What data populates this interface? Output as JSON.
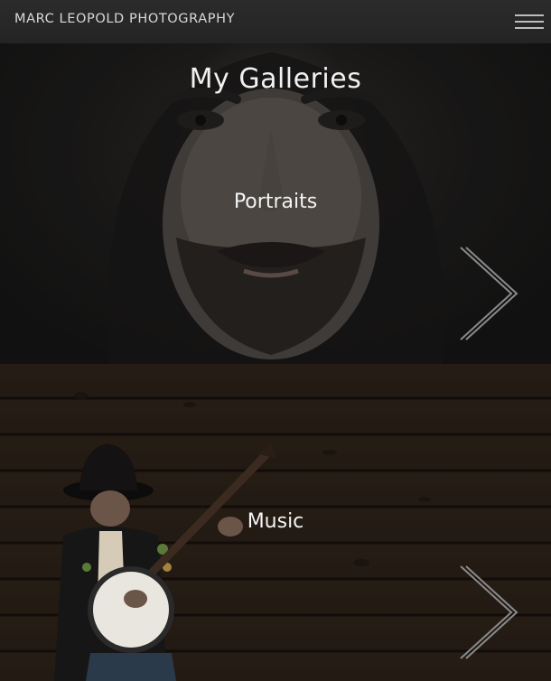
{
  "header": {
    "site_title": "MARC LEOPOLD PHOTOGRAPHY",
    "menu_icon": "hamburger-menu-icon"
  },
  "main": {
    "heading": "My Galleries",
    "galleries": [
      {
        "label": "Portraits",
        "icon": "chevron-right-icon"
      },
      {
        "label": "Music",
        "icon": "chevron-right-icon"
      }
    ]
  },
  "colors": {
    "header_background": "#272727",
    "header_text": "#d9d9d9",
    "heading_text": "#f1f1f1",
    "chevron_stroke": "#8a8a8a"
  }
}
